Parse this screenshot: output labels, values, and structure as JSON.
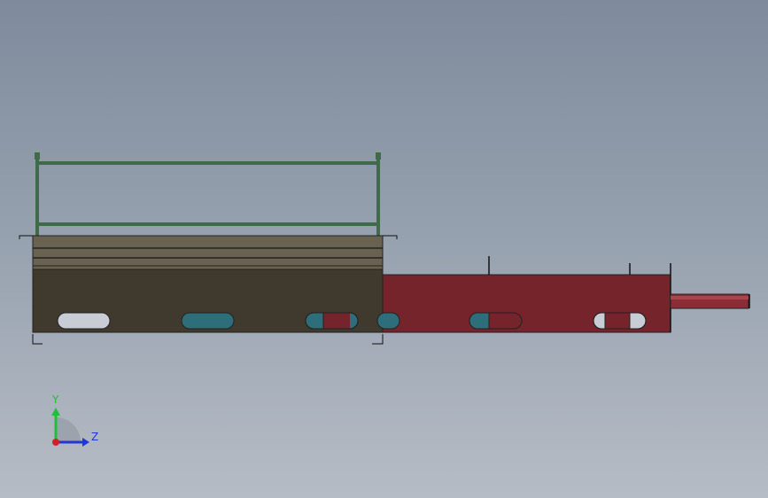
{
  "viewport": {
    "background_top": "#7f8b9c",
    "background_bottom": "#b6bcc5"
  },
  "model": {
    "railing_color": "#3f6b4a",
    "main_body_color": "#403a2e",
    "main_top_color": "#6a6250",
    "extension_color": "#74242a",
    "rod_color": "#8a2d36",
    "slot_light_color": "#c8ccd4",
    "slot_teal_color": "#2e6e7a"
  },
  "triad": {
    "y_label": "Y",
    "z_label": "Z",
    "y_color": "#1fbf3a",
    "z_color": "#2236d8",
    "x_color": "#d0202a"
  }
}
